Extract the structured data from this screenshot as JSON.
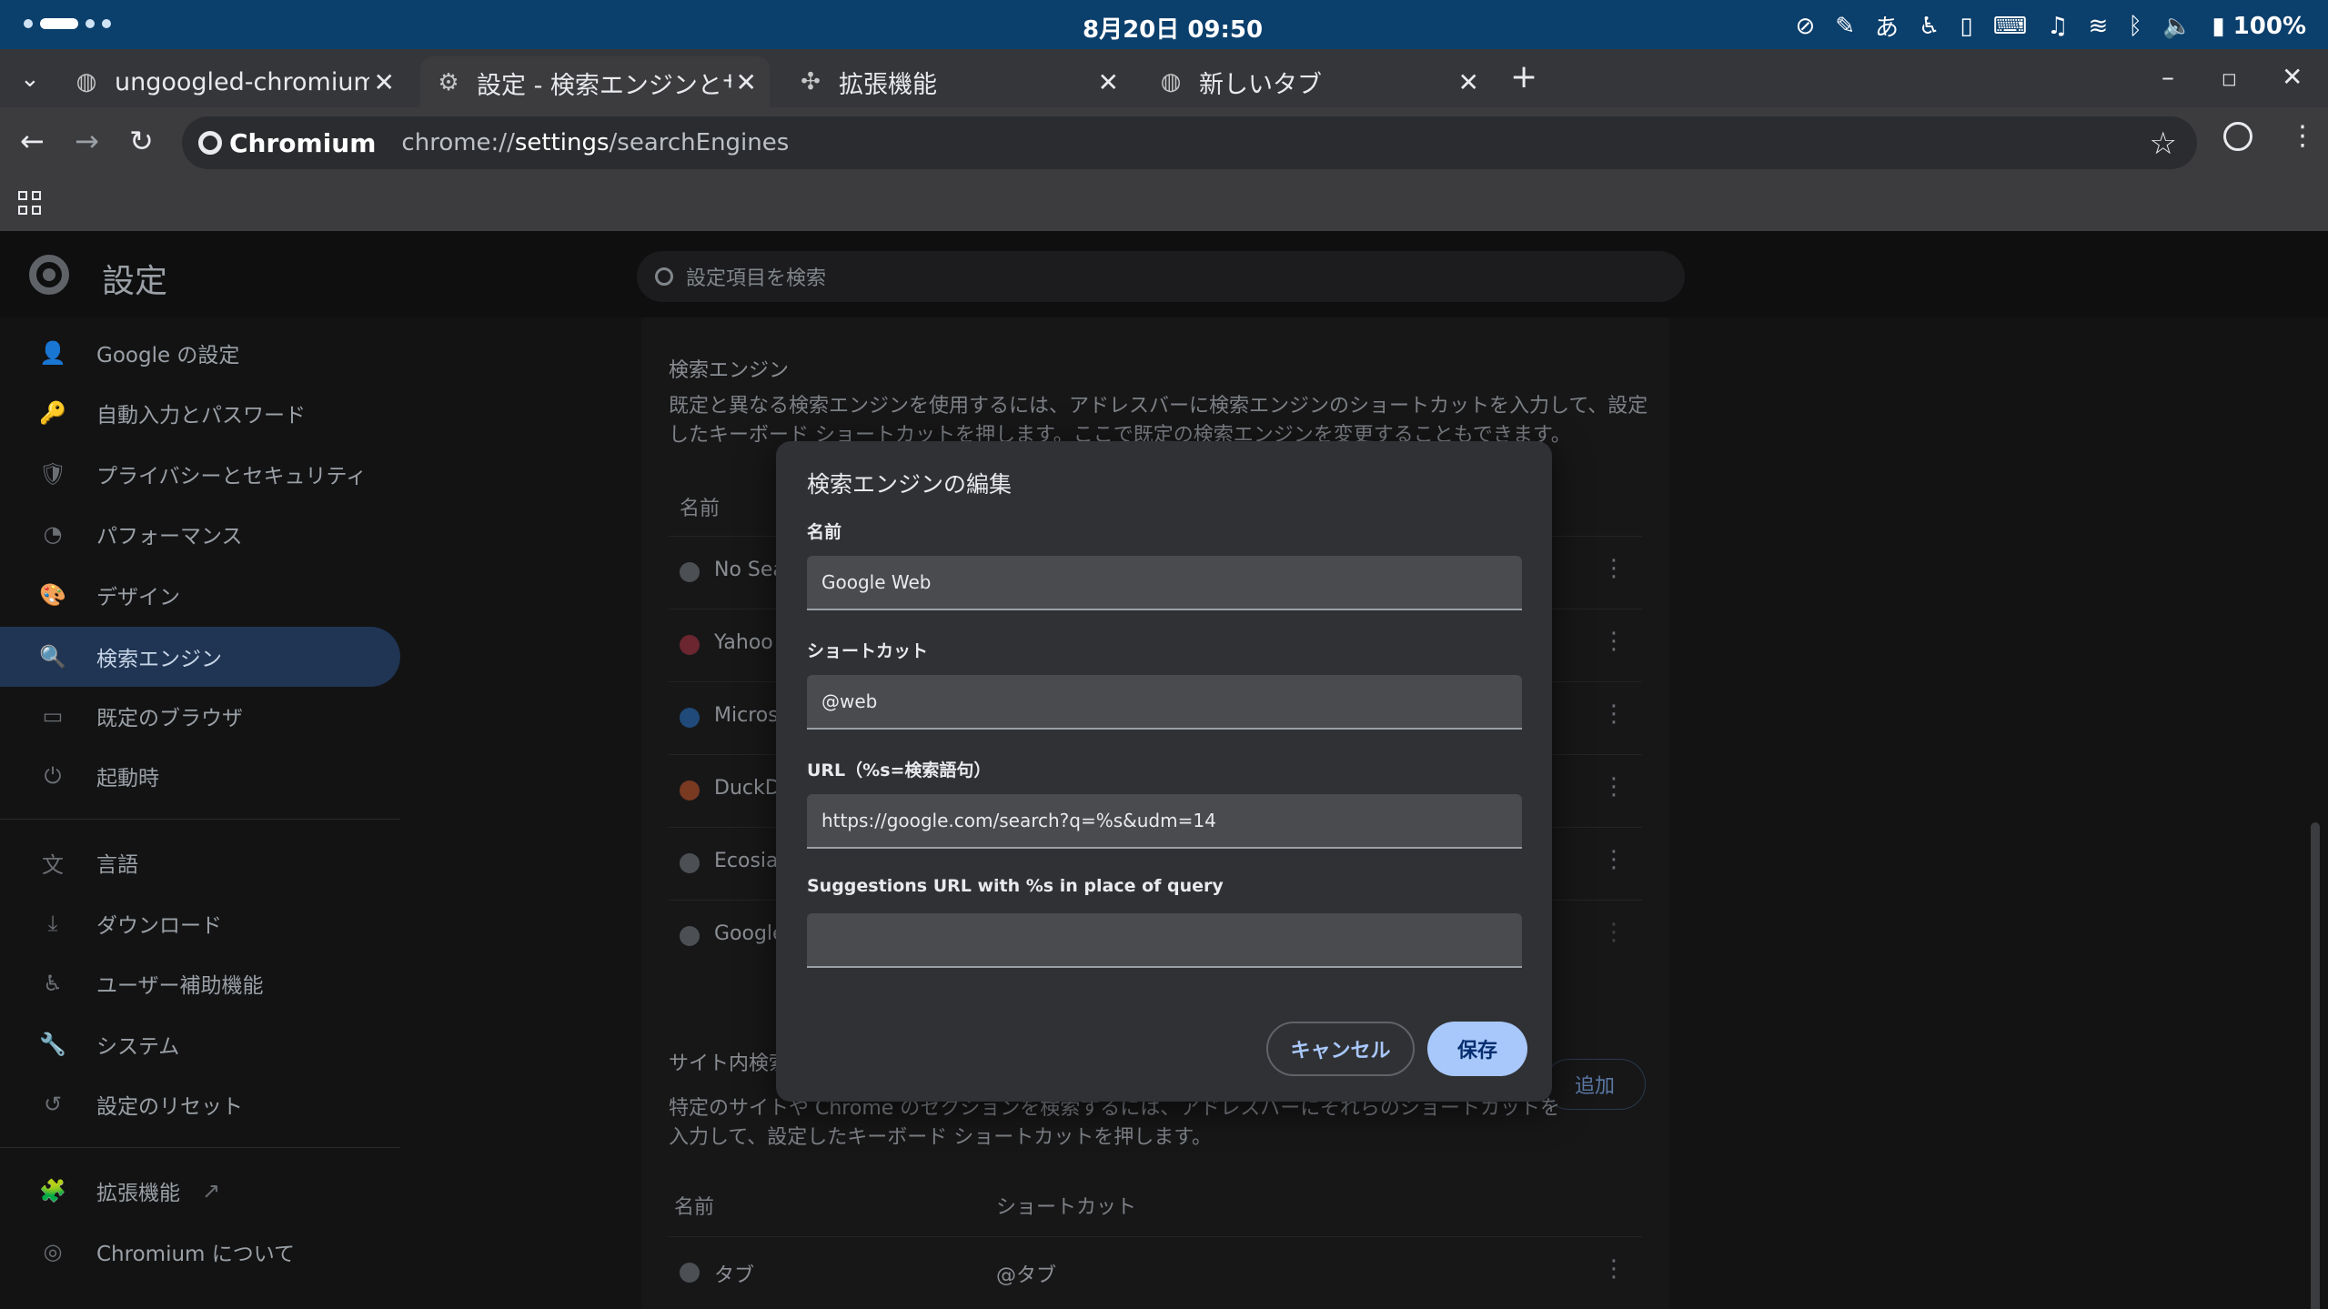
{
  "system": {
    "clock": "8月20日 09:50",
    "ime": "あ",
    "battery": "100%"
  },
  "tabs": [
    {
      "label": "ungoogled-chromium fi",
      "icon": "globe-icon"
    },
    {
      "label": "設定 - 検索エンジンとサ",
      "icon": "gear-icon"
    },
    {
      "label": "拡張機能",
      "icon": "puzzle-icon"
    },
    {
      "label": "新しいタブ",
      "icon": "globe-icon"
    }
  ],
  "address": {
    "origin": "Chromium",
    "url_prefix": "chrome://",
    "url_host": "settings",
    "url_path": "/searchEngines"
  },
  "settings": {
    "title": "設定",
    "search_placeholder": "設定項目を検索",
    "nav": [
      {
        "label": "Google の設定",
        "icon": "👤"
      },
      {
        "label": "自動入力とパスワード",
        "icon": "🔑"
      },
      {
        "label": "プライバシーとセキュリティ",
        "icon": "🛡"
      },
      {
        "label": "パフォーマンス",
        "icon": "◔"
      },
      {
        "label": "デザイン",
        "icon": "🎨"
      },
      {
        "label": "検索エンジン",
        "icon": "🔍"
      },
      {
        "label": "既定のブラウザ",
        "icon": "▭"
      },
      {
        "label": "起動時",
        "icon": "⏻"
      },
      {
        "label": "言語",
        "icon": "文"
      },
      {
        "label": "ダウンロード",
        "icon": "⤓"
      },
      {
        "label": "ユーザー補助機能",
        "icon": "♿"
      },
      {
        "label": "システム",
        "icon": "🔧"
      },
      {
        "label": "設定のリセット",
        "icon": "↺"
      },
      {
        "label": "拡張機能",
        "icon": "🧩"
      },
      {
        "label": "Chromium について",
        "icon": "◎"
      }
    ],
    "section_engines": "検索エンジン",
    "engines_desc": "既定と異なる検索エンジンを使用するには、アドレスバーに検索エンジンのショートカットを入力して、設定したキーボード ショートカットを押します。ここで既定の検索エンジンを変更することもできます。",
    "col_name": "名前",
    "engine_rows": [
      "No Sear",
      "Yahoo!",
      "Microso",
      "DuckDu",
      "Ecosia",
      "Google"
    ],
    "section_site": "サイト内検索",
    "site_desc": "特定のサイトや Chrome のセクションを検索するには、アドレスバーにそれらのショートカットを入力して、設定したキーボード ショートカットを押します。",
    "add_label": "追加",
    "col_name2": "名前",
    "col_shortcut": "ショートカット",
    "site_row_name": "タブ",
    "site_row_shortcut": "@タブ"
  },
  "dialog": {
    "title": "検索エンジンの編集",
    "name_label": "名前",
    "name_value": "Google Web",
    "shortcut_label": "ショートカット",
    "shortcut_value": "@web",
    "url_label": "URL（%s=検索語句）",
    "url_value": "https://google.com/search?q=%s&udm=14",
    "suggest_label": "Suggestions URL with %s in place of query",
    "suggest_value": "",
    "cancel_label": "キャンセル",
    "save_label": "保存"
  }
}
